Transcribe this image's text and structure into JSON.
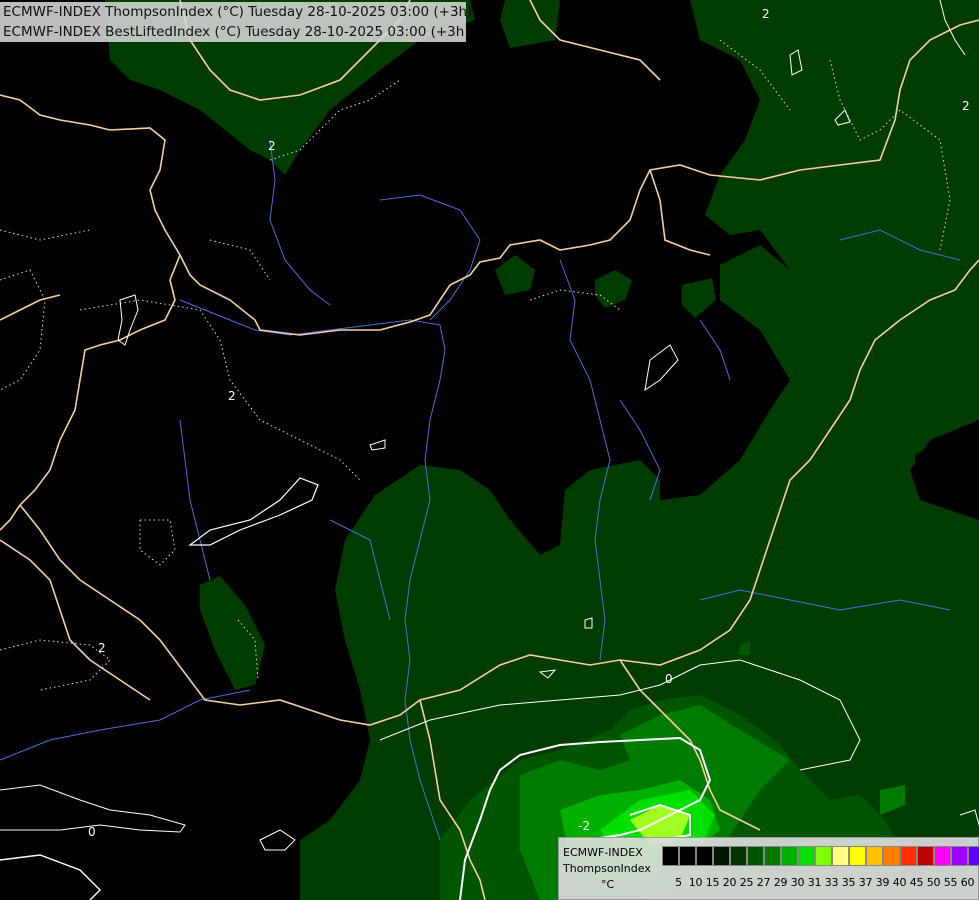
{
  "header": {
    "title_line1": "ECMWF-INDEX ThompsonIndex (°C) Tuesday 28-10-2025 03:00 (+3h)",
    "title_line2": "ECMWF-INDEX BestLiftedIndex (°C) Tuesday 28-10-2025 03:00 (+3h)"
  },
  "legend": {
    "line1": "ECMWF-INDEX",
    "line2": "ThompsonIndex",
    "line3": "°C",
    "ticks": [
      "5",
      "10",
      "15",
      "20",
      "25",
      "27",
      "29",
      "30",
      "31",
      "33",
      "35",
      "37",
      "39",
      "40",
      "45",
      "50",
      "55",
      "60"
    ],
    "colors": [
      "#000000",
      "#000000",
      "#000000",
      "#001800",
      "#003400",
      "#005500",
      "#007a00",
      "#00b000",
      "#00e000",
      "#80ff00",
      "#ffff80",
      "#ffff00",
      "#ffc000",
      "#ff8000",
      "#ff3000",
      "#c00000",
      "#ff00ff",
      "#a000ff",
      "#6000ff",
      "#0000ff"
    ]
  },
  "contour_labels": {
    "lifted_2": "2",
    "lifted_0": "0",
    "lifted_neg2": "-2"
  },
  "colors": {
    "background": "#000000",
    "index_dark": "#003400",
    "index_mid": "#005500",
    "index_light": "#007a00",
    "index_bright": "#00b000",
    "index_peak": "#00e000",
    "index_max": "#a0ff20",
    "borders": "#f5cfa0",
    "rivers": "#4a6ed8",
    "lifted_contours": "#ffffff"
  }
}
